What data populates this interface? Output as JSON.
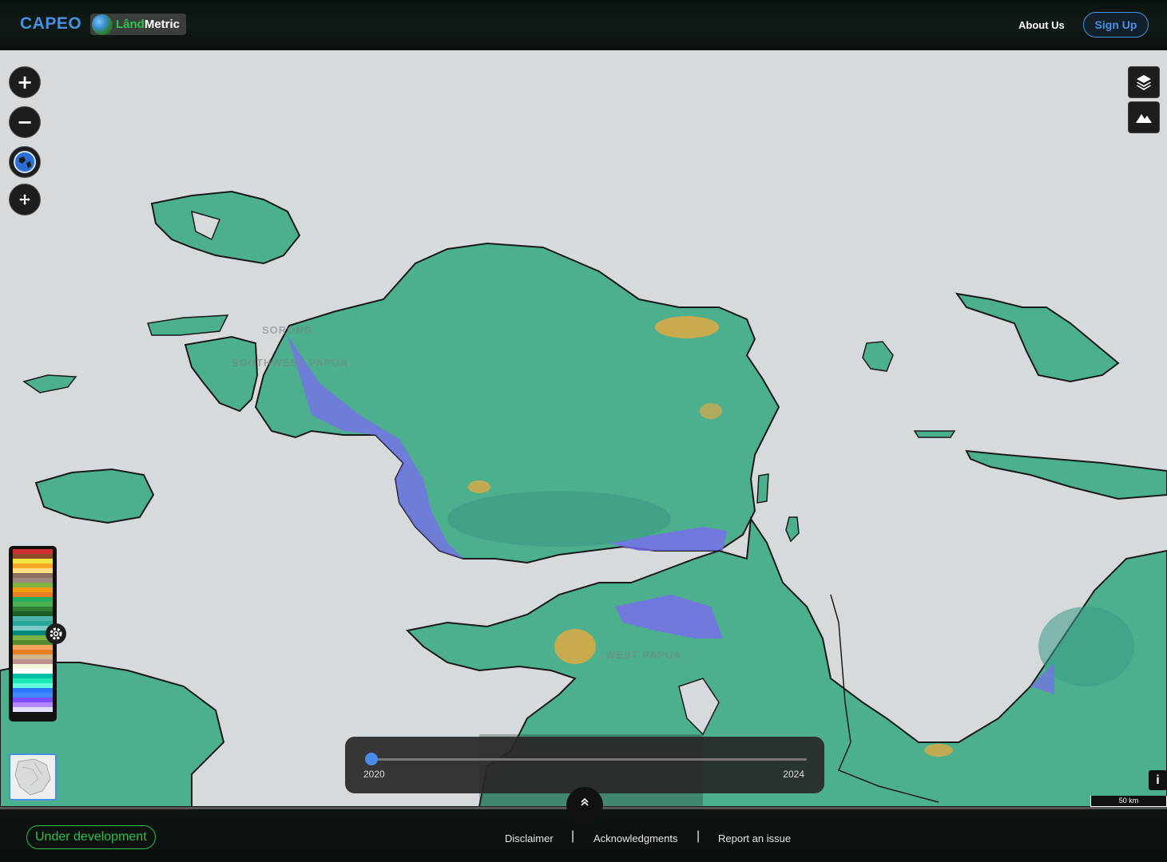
{
  "header": {
    "brand": "CAPEO",
    "partner_logo_part1": "Lând",
    "partner_logo_part2": "Metric",
    "about_label": "About Us",
    "signup_label": "Sign Up"
  },
  "map": {
    "place_labels": [
      "SORONG",
      "SOUTHWEST PAPUA",
      "WEST PAPUA"
    ],
    "scale_label": "50 km",
    "info_label": "i"
  },
  "controls": {
    "zoom_in": "+",
    "zoom_out": "−",
    "globe_icon": "globe-icon",
    "pan_icon": "move-icon",
    "layers_icon": "layers-icon",
    "terrain_icon": "mountain-icon",
    "settings_icon": "gear-icon"
  },
  "legend": {
    "colors": [
      "#d32f2f",
      "#8d4b2a",
      "#f5e642",
      "#f9a825",
      "#ffe082",
      "#8d6e63",
      "#a1887f",
      "#7cb342",
      "#f39c12",
      "#e67e22",
      "#27ae60",
      "#4caf50",
      "#2e7d32",
      "#1b5e20",
      "#4db6ac",
      "#26a69a",
      "#80cbc4",
      "#00897b",
      "#7cb342",
      "#558b2f",
      "#f4a460",
      "#e67e22",
      "#d2b48c",
      "#bc8f8f",
      "#f5f5dc",
      "#ffffff",
      "#00bfa5",
      "#1de9b6",
      "#64ffda",
      "#2979ff",
      "#448aff",
      "#7c4dff",
      "#b388ff",
      "#e0e0ff"
    ]
  },
  "timeline": {
    "start_year": "2020",
    "end_year": "2024",
    "selected_year": 2020
  },
  "footer": {
    "status_badge": "Under development",
    "disclaimer": "Disclaimer",
    "acknowledgments": "Acknowledgments",
    "report_issue": "Report an issue",
    "separator": "|"
  }
}
